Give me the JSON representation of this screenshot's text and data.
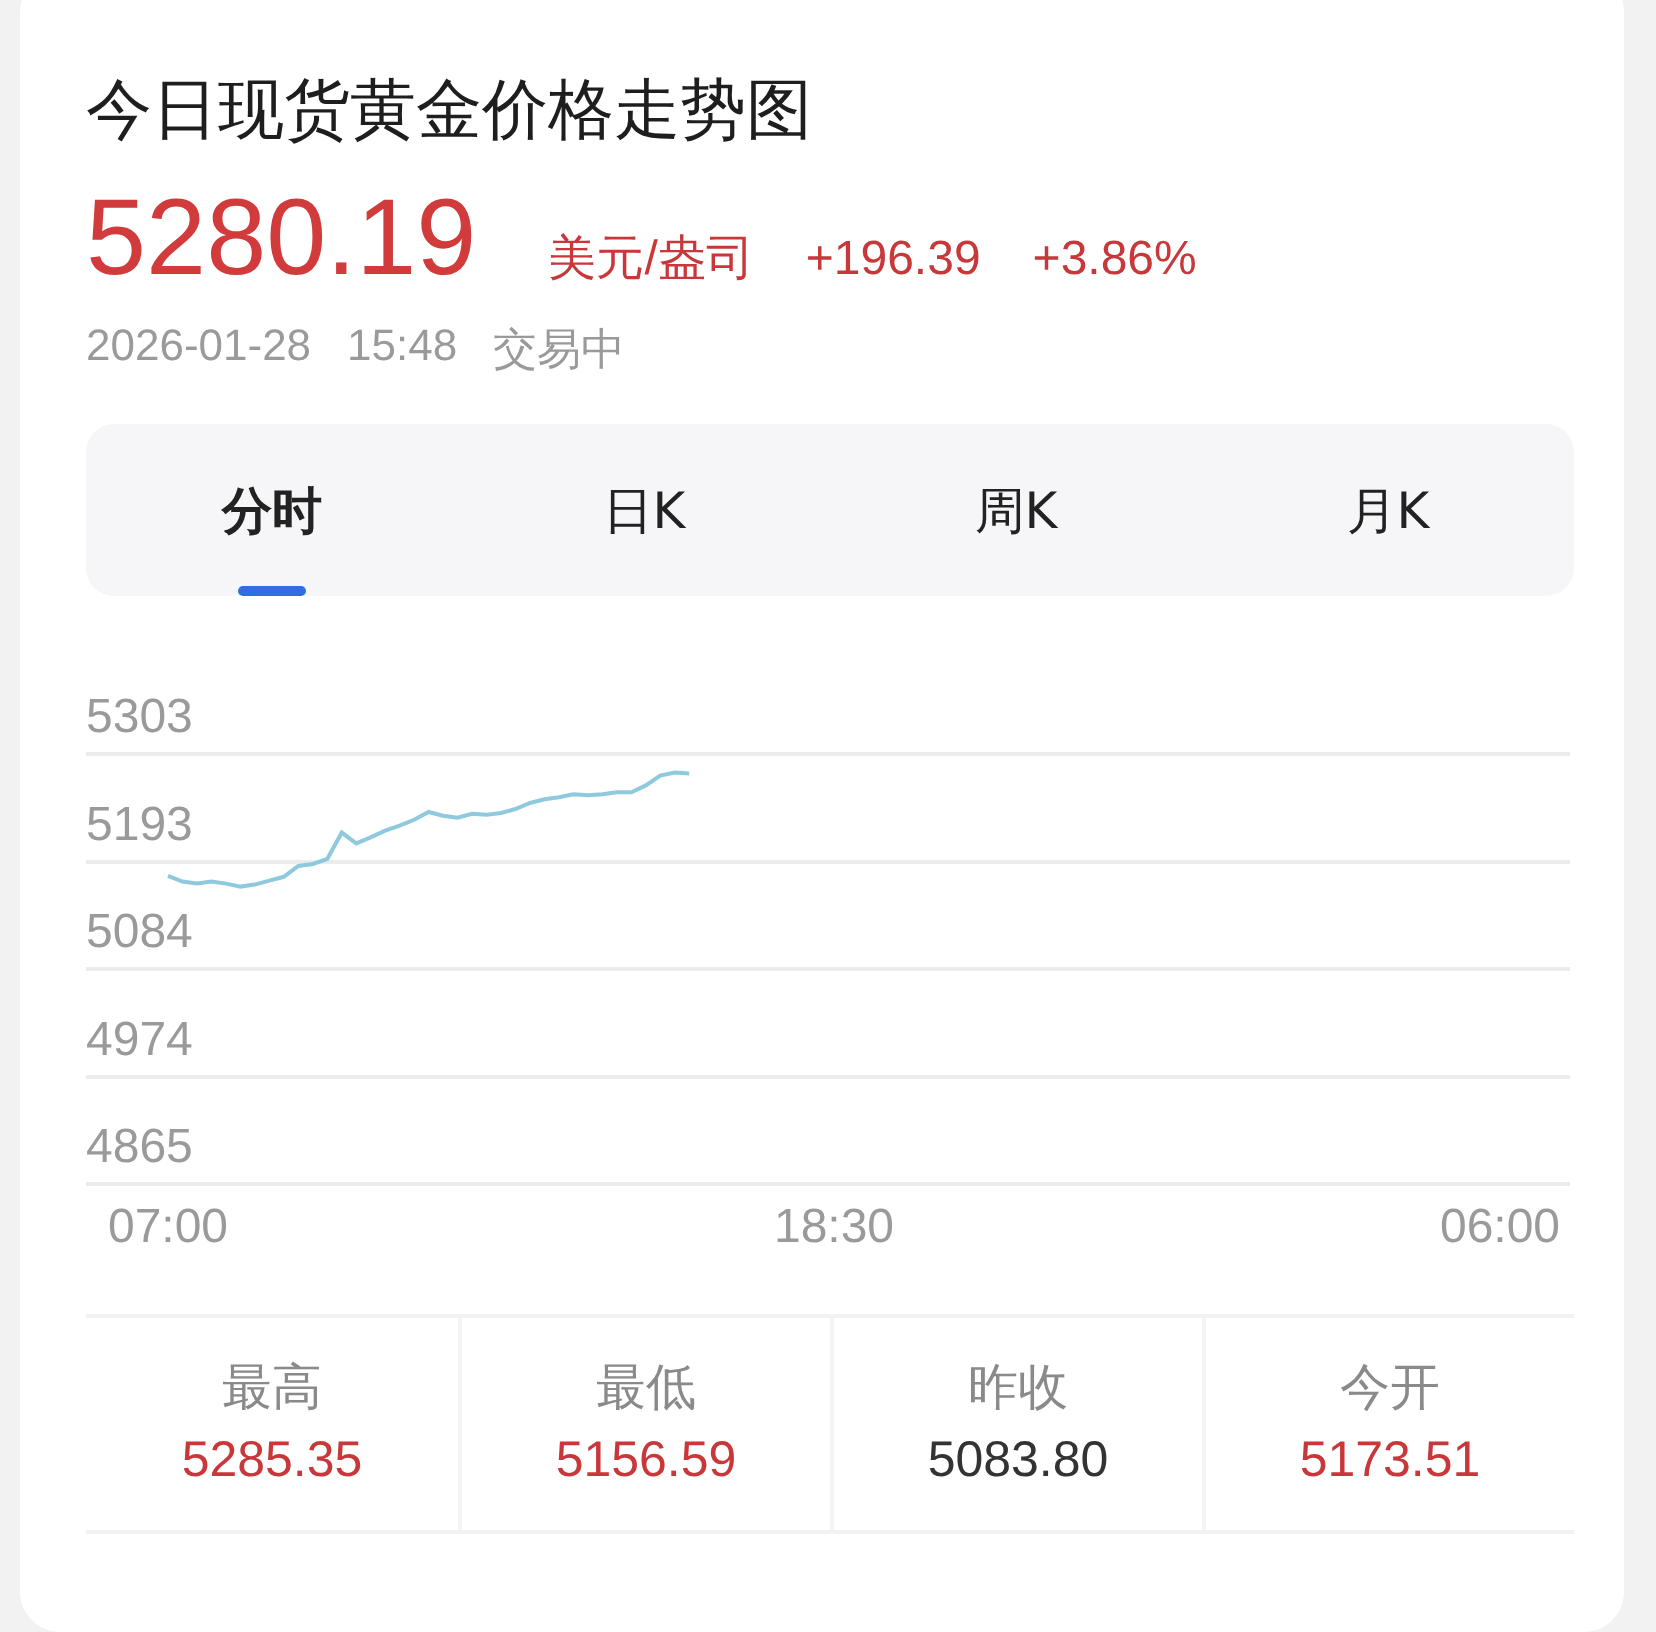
{
  "title": "今日现货黄金价格走势图",
  "quote": {
    "price": "5280.19",
    "unit": "美元/盎司",
    "change": "+196.39",
    "percent": "+3.86%",
    "date": "2026-01-28",
    "time": "15:48",
    "status": "交易中"
  },
  "tabs": [
    {
      "label": "分时",
      "selected": true
    },
    {
      "label": "日K",
      "selected": false
    },
    {
      "label": "周K",
      "selected": false
    },
    {
      "label": "月K",
      "selected": false
    }
  ],
  "chart": {
    "chart_data": {
      "type": "line",
      "grid": true,
      "ylim": [
        4865,
        5303
      ],
      "yticks": [
        5303,
        5193,
        5084,
        4974,
        4865
      ],
      "categories": [
        "07:00",
        null,
        null,
        null,
        null,
        null,
        null,
        null,
        null,
        null,
        null,
        null,
        null,
        null,
        null,
        null,
        null,
        null,
        null,
        null,
        null,
        null,
        null,
        null,
        null,
        null,
        null,
        null,
        null,
        null,
        null,
        null,
        null,
        null,
        null,
        null,
        null,
        null,
        null,
        null,
        null,
        null,
        null,
        null,
        null,
        null,
        "18:30",
        null,
        null,
        null,
        null,
        null,
        null,
        null,
        null,
        null,
        null,
        null,
        null,
        null,
        null,
        null,
        null,
        null,
        null,
        null,
        null,
        null,
        null,
        null,
        null,
        null,
        null,
        null,
        null,
        null,
        null,
        null,
        null,
        null,
        null,
        null,
        null,
        null,
        null,
        null,
        null,
        null,
        null,
        null,
        null,
        null,
        "06:00"
      ],
      "series": [
        {
          "color": "#8ec9de",
          "values": [
            5179,
            5173,
            5171,
            5173,
            5171,
            5168,
            5170,
            5174,
            5178,
            5189,
            5191,
            5196,
            5223,
            5212,
            5218,
            5225,
            5230,
            5236,
            5244,
            5240,
            5238,
            5242,
            5241,
            5243,
            5247,
            5253,
            5257,
            5259,
            5262,
            5261,
            5262,
            5264,
            5264,
            5271,
            5281,
            5284,
            5283,
            null,
            null,
            null,
            null,
            null,
            null,
            null,
            null,
            null,
            null,
            null,
            null,
            null,
            null,
            null,
            null,
            null,
            null,
            null,
            null,
            null,
            null,
            null,
            null,
            null,
            null,
            null,
            null,
            null,
            null,
            null,
            null,
            null,
            null,
            null,
            null,
            null,
            null,
            null,
            null,
            null,
            null,
            null,
            null,
            null,
            null,
            null,
            null,
            null,
            null,
            null,
            null,
            null,
            null,
            null,
            null
          ]
        }
      ]
    }
  },
  "stats": [
    {
      "label": "最高",
      "value": "5285.35",
      "color": "#c8383a"
    },
    {
      "label": "最低",
      "value": "5156.59",
      "color": "#c8383a"
    },
    {
      "label": "昨收",
      "value": "5083.80",
      "color": "#333333"
    },
    {
      "label": "今开",
      "value": "5173.51",
      "color": "#c8383a"
    }
  ]
}
